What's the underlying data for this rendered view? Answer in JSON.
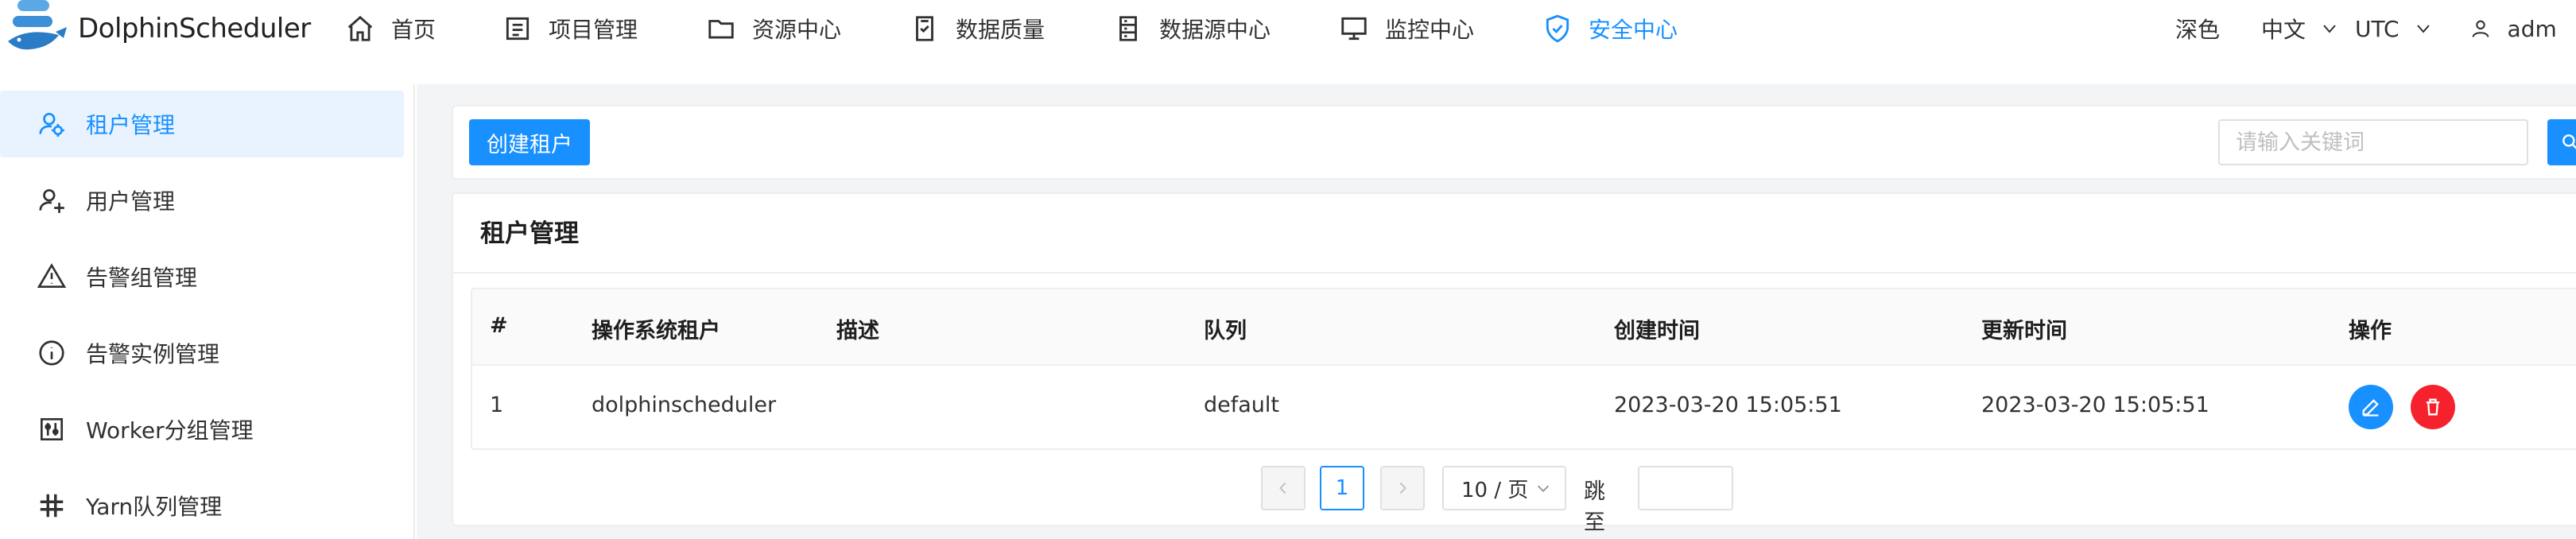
{
  "app": {
    "name": "DolphinScheduler"
  },
  "nav": {
    "items": [
      {
        "label": "首页",
        "icon": "home-icon"
      },
      {
        "label": "项目管理",
        "icon": "project-icon"
      },
      {
        "label": "资源中心",
        "icon": "folder-icon"
      },
      {
        "label": "数据质量",
        "icon": "quality-icon"
      },
      {
        "label": "数据源中心",
        "icon": "datasource-icon"
      },
      {
        "label": "监控中心",
        "icon": "monitor-icon"
      },
      {
        "label": "安全中心",
        "icon": "shield-icon",
        "active": true
      }
    ]
  },
  "header_right": {
    "theme": "深色",
    "language": "中文",
    "timezone": "UTC",
    "user": "adm"
  },
  "sidebar": {
    "items": [
      {
        "label": "租户管理",
        "icon": "tenant-icon",
        "active": true
      },
      {
        "label": "用户管理",
        "icon": "user-icon"
      },
      {
        "label": "告警组管理",
        "icon": "warning-icon"
      },
      {
        "label": "告警实例管理",
        "icon": "info-icon"
      },
      {
        "label": "Worker分组管理",
        "icon": "worker-group-icon"
      },
      {
        "label": "Yarn队列管理",
        "icon": "yarn-queue-icon"
      }
    ]
  },
  "toolbar": {
    "create_label": "创建租户",
    "search_placeholder": "请输入关键词",
    "search_icon": "search-icon"
  },
  "card": {
    "title": "租户管理",
    "columns": [
      "#",
      "操作系统租户",
      "描述",
      "队列",
      "创建时间",
      "更新时间",
      "操作"
    ],
    "rows": [
      {
        "index": "1",
        "tenant": "dolphinscheduler",
        "description": "",
        "queue": "default",
        "created": "2023-03-20 15:05:51",
        "updated": "2023-03-20 15:05:51"
      }
    ]
  },
  "pagination": {
    "current_page": "1",
    "page_size": "10 / 页",
    "jump_label": "跳至"
  },
  "colors": {
    "accent": "#1890ff",
    "danger": "#f5222d",
    "active_bg": "#e8f3ff",
    "main_bg": "#f3f4f6"
  }
}
